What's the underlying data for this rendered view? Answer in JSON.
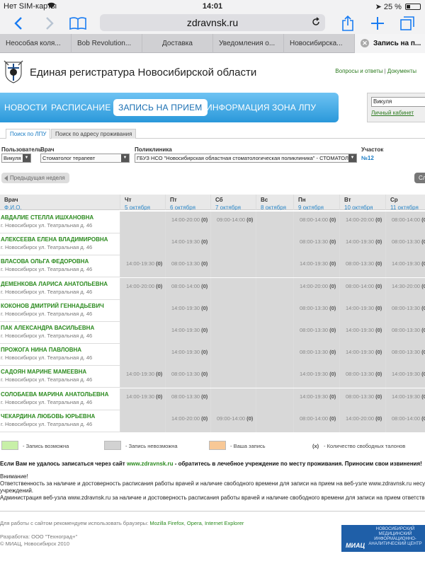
{
  "status_bar": {
    "carrier": "Нет SIM-карты",
    "time": "14:01",
    "battery": "25 %",
    "battery_level": 0.25
  },
  "browser": {
    "url": "zdravnsk.ru"
  },
  "tabs": [
    {
      "label": "Неособая коля..."
    },
    {
      "label": "Bob Revolution..."
    },
    {
      "label": "Доставка"
    },
    {
      "label": "Уведомления о..."
    },
    {
      "label": "Новосибирска..."
    },
    {
      "label": "Запись на п..."
    }
  ],
  "header": {
    "title": "Единая регистратура Новосибирской области",
    "link_faq": "Вопросы и ответы",
    "separator": "|",
    "link_docs": "Документы"
  },
  "nav": {
    "items": [
      "НОВОСТИ",
      "РАСПИСАНИЕ",
      "ЗАПИСЬ НА ПРИЕМ",
      "ИНФОРМАЦИЯ",
      "ЗОНА ЛПУ"
    ]
  },
  "login": {
    "user": "Викуля",
    "cabinet": "Личный кабинет"
  },
  "subtabs": [
    "Поиск по ЛПУ",
    "Поиск по адресу проживания"
  ],
  "filters": {
    "user_label": "Пользователь",
    "user_value": "Викуля",
    "doctor_label": "Врач",
    "doctor_value": "Стоматолог терапевт",
    "clinic_label": "Поликлиника",
    "clinic_value": "ГБУЗ НСО \"Новосибирская областная стоматологическая поликлиника\" - СТОМАТОЛОГИЯ",
    "section_label": "Участок",
    "section_value": "№12"
  },
  "week_nav": {
    "prev": "Предыдущая неделя",
    "next": "Сл"
  },
  "table": {
    "doctor_header": "Врач",
    "doctor_subheader": "Ф.И.О.",
    "days": [
      {
        "dow": "Чт",
        "date": "5 октября"
      },
      {
        "dow": "Пт",
        "date": "6 октября"
      },
      {
        "dow": "Сб",
        "date": "7 октября"
      },
      {
        "dow": "Вс",
        "date": "8 октября"
      },
      {
        "dow": "Пн",
        "date": "9 октября"
      },
      {
        "dow": "Вт",
        "date": "10 октября"
      },
      {
        "dow": "Ср",
        "date": "11 октября"
      }
    ],
    "address": "г. Новосибирск ул. Театральная д. 46",
    "free_count": "(0)",
    "rows": [
      {
        "name": "АВДАЛИЕ СТЕЛЛА ИШХАНОВНА",
        "slots": [
          "",
          "14:00-20:00",
          "09:00-14:00",
          "",
          "08:00-14:00",
          "14:00-20:00",
          "08:00-14:00"
        ]
      },
      {
        "name": "АЛЕКСЕЕВА ЕЛЕНА ВЛАДИМИРОВНА",
        "slots": [
          "",
          "14:00-19:30",
          "",
          "",
          "08:00-13:30",
          "14:00-19:30",
          "08:00-13:30"
        ]
      },
      {
        "name": "ВЛАСОВА ОЛЬГА ФЕДОРОВНА",
        "slots": [
          "14:00-19:30",
          "08:00-13:30",
          "",
          "",
          "14:00-19:30",
          "08:00-13:30",
          "14:00-19:30"
        ]
      },
      {
        "name": "ДЕМЕНКОВА ЛАРИСА АНАТОЛЬЕВНА",
        "slots": [
          "14:00-20:00",
          "08:00-14:00",
          "",
          "",
          "14:00-20:00",
          "08:00-14:00",
          "14:30-20:00"
        ]
      },
      {
        "name": "КОКОНОВ ДМИТРИЙ ГЕННАДЬЕВИЧ",
        "slots": [
          "",
          "14:00-19:30",
          "",
          "",
          "08:00-13:30",
          "14:00-19:30",
          "08:00-13:30"
        ]
      },
      {
        "name": "ПАК АЛЕКСАНДРА ВАСИЛЬЕВНА",
        "slots": [
          "",
          "14:00-19:30",
          "",
          "",
          "08:00-13:30",
          "14:00-19:30",
          "08:00-13:30"
        ]
      },
      {
        "name": "ПРОЖОГА НИНА ПАВЛОВНА",
        "slots": [
          "",
          "14:00-19:30",
          "",
          "",
          "08:00-13:30",
          "14:00-19:30",
          "08:00-13:30"
        ]
      },
      {
        "name": "САДОЯН МАРИНЕ МАМЕЕВНА",
        "slots": [
          "14:00-19:30",
          "08:00-13:30",
          "",
          "",
          "14:00-19:30",
          "08:00-13:30",
          "14:00-19:30"
        ]
      },
      {
        "name": "СОЛОБАЕВА МАРИНА АНАТОЛЬЕВНА",
        "slots": [
          "14:00-19:30",
          "08:00-13:30",
          "",
          "",
          "14:00-19:30",
          "08:00-13:30",
          "14:00-19:30"
        ]
      },
      {
        "name": "ЧЕКАРДИНА ЛЮБОВЬ ЮРЬЕВНА",
        "slots": [
          "",
          "14:00-20:00",
          "09:00-14:00",
          "",
          "08:00-14:00",
          "14:00-20:00",
          "08:00-14:00"
        ]
      }
    ]
  },
  "legend": {
    "possible": "- Запись возможна",
    "impossible": "- Запись невозможна",
    "yours": "- Ваша запись",
    "count_mark": "(x)",
    "count": "- Количество свободных талонов",
    "colors": {
      "possible": "#c8f0a8",
      "impossible": "#d2d2d2",
      "yours": "#f8c896"
    }
  },
  "notice": {
    "prefix": "Если Вам не удалось записаться через сайт",
    "link": "www.zdravnsk.ru",
    "suffix": "- обратитесь в лечебное учреждение по месту проживания. Приносим свои извинения!"
  },
  "attention": {
    "title": "Внимание!",
    "line1": "Ответственность за наличие и достоверность расписания работы врачей и наличие свободного времени для записи на прием на веб-узле www.zdravnsk.ru несут руководител",
    "line2": "учреждений.",
    "line3": "Администрация веб-узла www.zdravnsk.ru за наличие и достоверность расписания работы врачей и наличие свободного времени для записи на прием ответственность не несет"
  },
  "footer": {
    "browsers_text": "Для работы с сайтом рекомендуем использовать браузеры:",
    "firefox": "Mozilla Firefox",
    "opera": "Opera",
    "ie": "Internet Explorer",
    "dev": "Разработка: ООО \"Техноград+\"",
    "copy": "© МИАЦ, Новосибирск 2010",
    "miac_short": "МИАЦ",
    "miac_text": "НОВОСИБИРСКИЙ МЕДИЦИНСКИЙ ИНФОРМАЦИОННО-АНАЛИТИЧЕСКИЙ ЦЕНТР"
  }
}
